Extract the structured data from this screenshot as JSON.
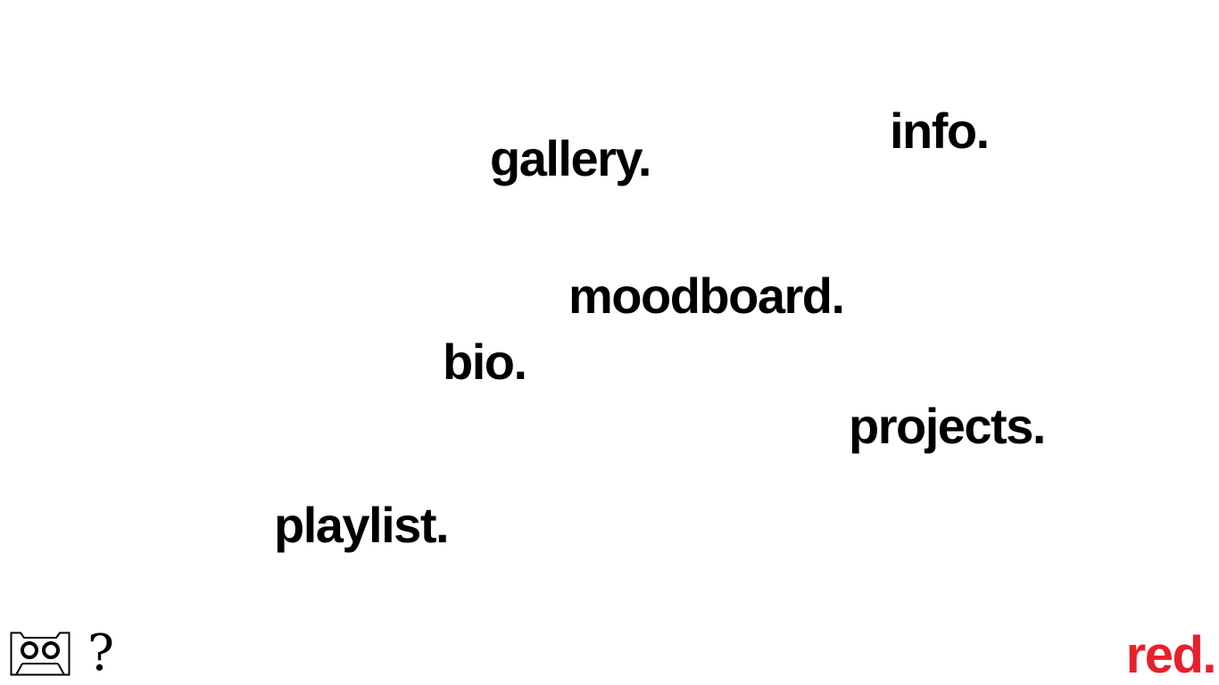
{
  "nav": {
    "info": "info.",
    "gallery": "gallery.",
    "moodboard": "moodboard.",
    "bio": "bio.",
    "projects": "projects.",
    "playlist": "playlist."
  },
  "footer": {
    "cassette_icon": "cassette-icon",
    "help_label": "?",
    "brand": "red."
  },
  "colors": {
    "background": "#ffffff",
    "text": "#000000",
    "brand": "#e8202a"
  }
}
